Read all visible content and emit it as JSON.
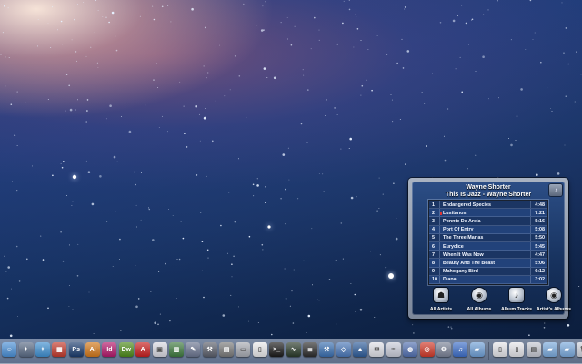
{
  "widget": {
    "artist": "Wayne Shorter",
    "album_title": "This Is Jazz - Wayne Shorter",
    "tracks": [
      {
        "num": "1",
        "title": "Endangered Species",
        "duration": "4:48"
      },
      {
        "num": "2",
        "title": "Lusitanos",
        "duration": "7:21"
      },
      {
        "num": "3",
        "title": "Ponnte De Areia",
        "duration": "5:16"
      },
      {
        "num": "4",
        "title": "Port Of Entry",
        "duration": "5:08"
      },
      {
        "num": "5",
        "title": "The Three Marias",
        "duration": "5:50"
      },
      {
        "num": "6",
        "title": "Eurydice",
        "duration": "5:45"
      },
      {
        "num": "7",
        "title": "When It Was Now",
        "duration": "4:47"
      },
      {
        "num": "8",
        "title": "Beauty And The Beast",
        "duration": "5:06"
      },
      {
        "num": "9",
        "title": "Mahogany Bird",
        "duration": "6:12"
      },
      {
        "num": "10",
        "title": "Diana",
        "duration": "3:02"
      }
    ],
    "playing_track_index": 1,
    "nav": [
      {
        "label": "All Artists",
        "icon": "person-icon"
      },
      {
        "label": "All Albums",
        "icon": "disc-icon"
      },
      {
        "label": "Album Tracks",
        "icon": "music-note-icon"
      },
      {
        "label": "Artist's Albums",
        "icon": "disc-icon"
      }
    ]
  },
  "dock": {
    "items": [
      {
        "name": "finder-icon",
        "color": "#4a8fd6",
        "glyph": "☺"
      },
      {
        "name": "launchpad-icon",
        "color": "#5a6b85",
        "glyph": "✦"
      },
      {
        "name": "safari-icon",
        "color": "#3f8fd0",
        "glyph": "✧"
      },
      {
        "name": "calendar-icon",
        "color": "#c23a2c",
        "glyph": "▦"
      },
      {
        "name": "photoshop-icon",
        "color": "#1b3c6e",
        "glyph": "Ps"
      },
      {
        "name": "illustrator-icon",
        "color": "#d2781a",
        "glyph": "Ai"
      },
      {
        "name": "indesign-icon",
        "color": "#b3196b",
        "glyph": "Id"
      },
      {
        "name": "dreamweaver-icon",
        "color": "#4d8a1a",
        "glyph": "Dw"
      },
      {
        "name": "acrobat-icon",
        "color": "#c71f1f",
        "glyph": "A"
      },
      {
        "name": "preview-icon",
        "color": "#d8d8e0",
        "glyph": "▣"
      },
      {
        "name": "chart-app-icon",
        "color": "#3f7a3f",
        "glyph": "▥"
      },
      {
        "name": "pencil-app-icon",
        "color": "#6b7590",
        "glyph": "✎"
      },
      {
        "name": "tools-icon",
        "color": "#5b5f6b",
        "glyph": "⚒"
      },
      {
        "name": "grid-app-icon",
        "color": "#7a7a7a",
        "glyph": "▤"
      },
      {
        "name": "hard-drive-icon",
        "color": "#a7aab2",
        "glyph": "▭"
      },
      {
        "name": "document-icon",
        "color": "#e8e8ea",
        "glyph": "▯"
      },
      {
        "name": "terminal-icon",
        "color": "#1a1a1a",
        "glyph": ">_"
      },
      {
        "name": "activity-monitor-icon",
        "color": "#2a3a2a",
        "glyph": "∿"
      },
      {
        "name": "console-icon",
        "color": "#2c2c2c",
        "glyph": "≣"
      },
      {
        "name": "xcode-icon",
        "color": "#3a6fb0",
        "glyph": "⚒"
      },
      {
        "name": "flowchart-icon",
        "color": "#4b78b8",
        "glyph": "◇"
      },
      {
        "name": "image-app-icon",
        "color": "#2f5d9a",
        "glyph": "▲"
      },
      {
        "name": "paper-icon",
        "color": "#dedfe6",
        "glyph": "✉"
      },
      {
        "name": "feather-icon",
        "color": "#c9ccd8",
        "glyph": "✒"
      },
      {
        "name": "globe-icon",
        "color": "#5270b0",
        "glyph": "◍"
      },
      {
        "name": "target-icon",
        "color": "#d03a2a",
        "glyph": "◎"
      },
      {
        "name": "system-prefs-icon",
        "color": "#7a8296",
        "glyph": "⚙"
      },
      {
        "name": "itunes-icon",
        "color": "#3e6fc9",
        "glyph": "♫"
      },
      {
        "name": "folder-icon",
        "color": "#6f9fd6",
        "glyph": "▰"
      },
      {
        "name": "file-icon",
        "color": "#e4e4e8",
        "glyph": "▯"
      },
      {
        "name": "file-icon",
        "color": "#e4e4e8",
        "glyph": "▯"
      },
      {
        "name": "archive-icon",
        "color": "#c4c7d0",
        "glyph": "▤"
      },
      {
        "name": "folder-icon",
        "color": "#7aa9dc",
        "glyph": "▰"
      },
      {
        "name": "folder-icon",
        "color": "#7aa9dc",
        "glyph": "▰"
      },
      {
        "name": "trash-icon",
        "color": "#cfd3dc",
        "glyph": "🗑"
      }
    ]
  }
}
